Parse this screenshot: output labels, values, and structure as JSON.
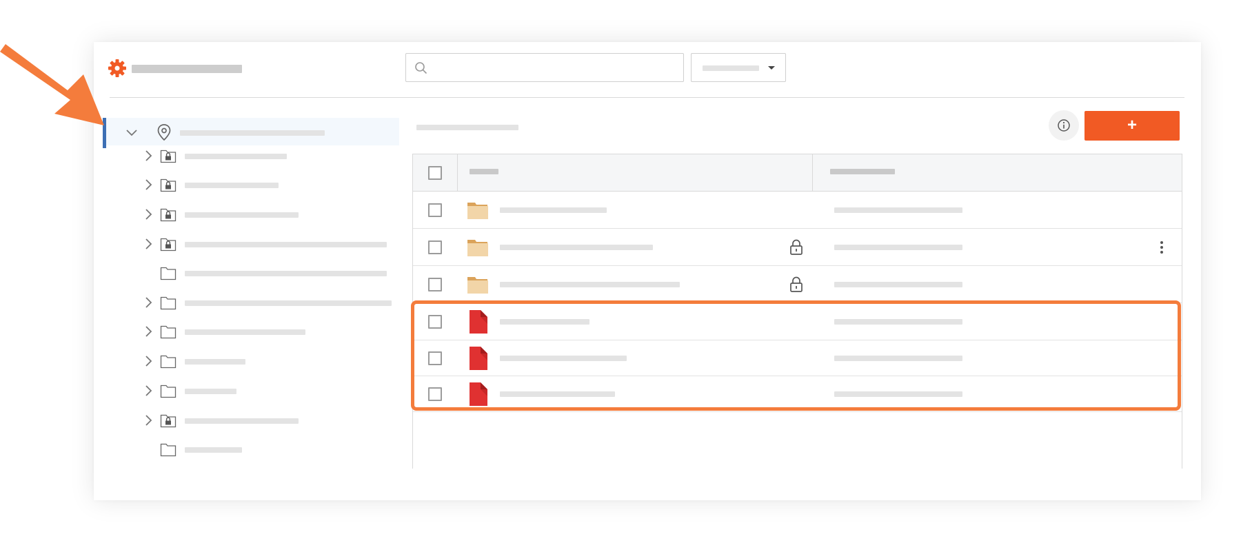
{
  "header": {
    "logo_icon": "gear-icon",
    "search": {
      "placeholder": "",
      "icon": "search-icon"
    },
    "filter_dropdown": {
      "icon": "caret-down-icon"
    }
  },
  "tree": {
    "root": {
      "icon": "map-pin-icon",
      "expanded": true,
      "selected": true
    },
    "items": [
      {
        "icon": "locked-folder-icon",
        "expandable": true
      },
      {
        "icon": "locked-folder-icon",
        "expandable": true
      },
      {
        "icon": "locked-folder-icon",
        "expandable": true
      },
      {
        "icon": "locked-folder-icon",
        "expandable": true
      },
      {
        "icon": "folder-icon",
        "expandable": false
      },
      {
        "icon": "folder-icon",
        "expandable": true
      },
      {
        "icon": "folder-icon",
        "expandable": true
      },
      {
        "icon": "folder-icon",
        "expandable": true
      },
      {
        "icon": "folder-icon",
        "expandable": true
      },
      {
        "icon": "locked-folder-icon",
        "expandable": true
      },
      {
        "icon": "folder-icon",
        "expandable": false
      }
    ]
  },
  "toolbar": {
    "info_icon": "info-icon",
    "add_button_label": "+"
  },
  "table": {
    "rows": [
      {
        "type": "folder",
        "locked": false,
        "menu": false,
        "highlighted": false
      },
      {
        "type": "folder",
        "locked": true,
        "menu": true,
        "highlighted": false
      },
      {
        "type": "folder",
        "locked": true,
        "menu": false,
        "highlighted": false
      },
      {
        "type": "pdf",
        "locked": false,
        "menu": false,
        "highlighted": true
      },
      {
        "type": "pdf",
        "locked": false,
        "menu": false,
        "highlighted": true
      },
      {
        "type": "pdf",
        "locked": false,
        "menu": false,
        "highlighted": true
      }
    ]
  },
  "annotation": {
    "arrow_color": "#f47c3c",
    "highlight_color": "#f47c3c"
  },
  "colors": {
    "accent": "#f15a24",
    "selected_bar": "#3d6fb4",
    "folder": "#f2d5a8",
    "pdf": "#e03131"
  }
}
